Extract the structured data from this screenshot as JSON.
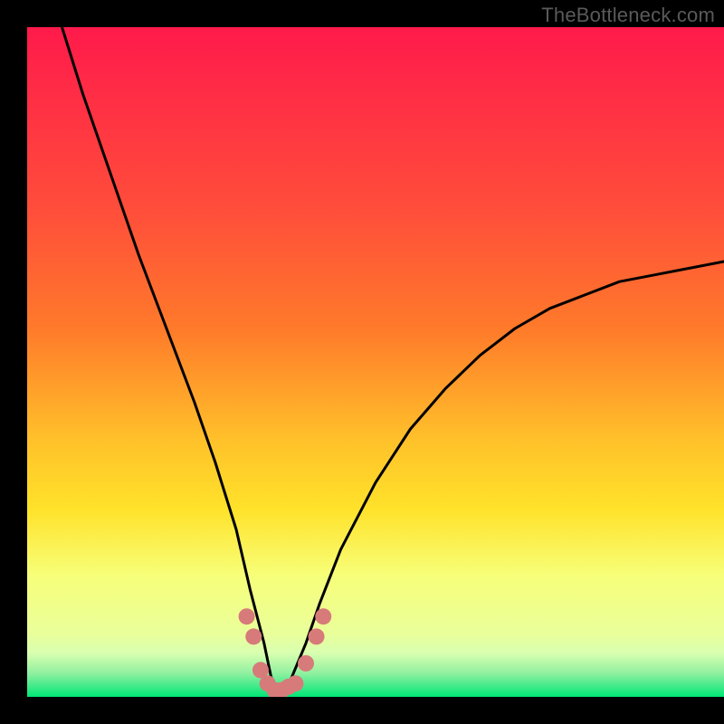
{
  "watermark_text": "TheBottleneck.com",
  "chart_data": {
    "type": "line",
    "title": "",
    "xlabel": "",
    "ylabel": "",
    "x_range": [
      0,
      100
    ],
    "y_range": [
      0,
      100
    ],
    "gradient_colors": {
      "top": "#ff1a4b",
      "mid_upper": "#ff7a2a",
      "mid": "#ffe22a",
      "mid_lower": "#f7ff7a",
      "lower_band": "#d8ffb0",
      "bottom": "#00e676"
    },
    "annotations": [
      {
        "note": "V-shaped black curve; minimum near x≈36, wider valley rising to right edge at y≈65"
      }
    ],
    "series": [
      {
        "name": "bottleneck-curve",
        "x": [
          5,
          8,
          12,
          16,
          20,
          24,
          27,
          30,
          32,
          34,
          35,
          36,
          37,
          38,
          40,
          42,
          45,
          50,
          55,
          60,
          65,
          70,
          75,
          80,
          85,
          90,
          95,
          100
        ],
        "y": [
          100,
          90,
          78,
          66,
          55,
          44,
          35,
          25,
          16,
          8,
          3,
          1,
          1,
          3,
          8,
          14,
          22,
          32,
          40,
          46,
          51,
          55,
          58,
          60,
          62,
          63,
          64,
          65
        ]
      }
    ],
    "markers": {
      "name": "valley-dots",
      "color": "#d77a7a",
      "points": [
        {
          "x": 31.5,
          "y": 12
        },
        {
          "x": 32.5,
          "y": 9
        },
        {
          "x": 33.5,
          "y": 4
        },
        {
          "x": 34.5,
          "y": 2
        },
        {
          "x": 35.5,
          "y": 1
        },
        {
          "x": 36.5,
          "y": 1
        },
        {
          "x": 37.5,
          "y": 1.5
        },
        {
          "x": 38.5,
          "y": 2
        },
        {
          "x": 40.0,
          "y": 5
        },
        {
          "x": 41.5,
          "y": 9
        },
        {
          "x": 42.5,
          "y": 12
        }
      ]
    }
  }
}
